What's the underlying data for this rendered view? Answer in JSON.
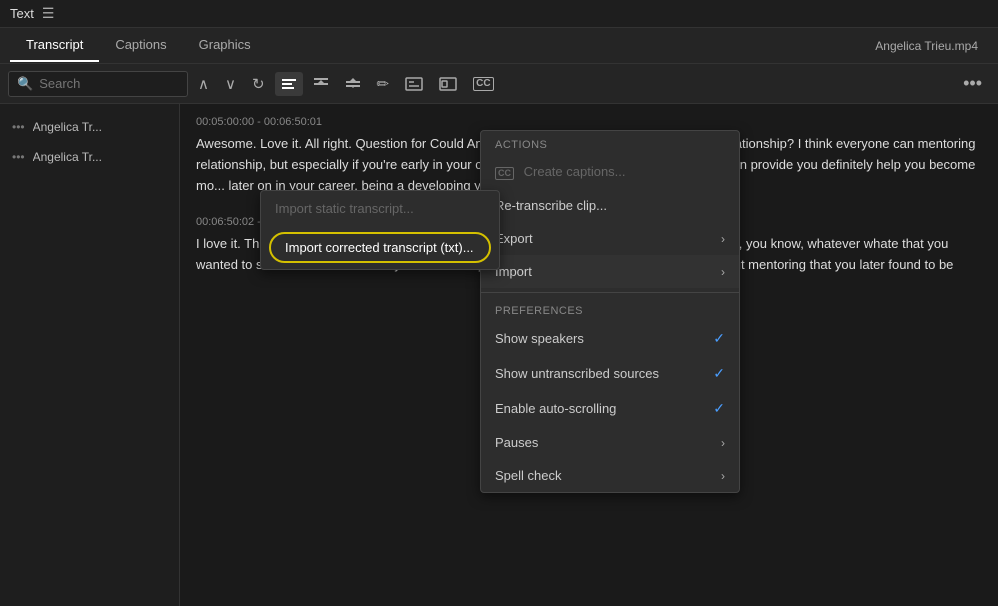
{
  "topbar": {
    "title": "Text",
    "menu_icon": "☰"
  },
  "tabs": {
    "items": [
      {
        "label": "Transcript",
        "active": true
      },
      {
        "label": "Captions",
        "active": false
      },
      {
        "label": "Graphics",
        "active": false
      }
    ],
    "file_label": "Angelica Trieu.mp4"
  },
  "toolbar": {
    "search_placeholder": "Search",
    "search_icon": "🔍",
    "nav_up_icon": "∧",
    "nav_down_icon": "∨",
    "refresh_icon": "↻",
    "align_icon": "≡",
    "split_icon": "⌥",
    "merge_icon": "⌂",
    "edit_icon": "✏",
    "caption_icon": "CC",
    "more_icon": "..."
  },
  "sidebar": {
    "items": [
      {
        "name": "Angelica Tr...",
        "dots": true
      },
      {
        "name": "Angelica Tr...",
        "dots": true
      }
    ]
  },
  "transcript": {
    "blocks": [
      {
        "id": "block1",
        "header": "00:05:00:00 - 00:06:50:01",
        "text": "Awesome. Love it. All right. Question for Could Angelica, who can benefit from a mentoring relationship? I think everyone can mentoring relationship, but especially if you're early in your career, Hearing about having a mentor that can provide you definitely help you become mo... later on in your career, being a developing your leadership ski..."
      },
      {
        "id": "block2",
        "header": "00:06:50:02 - 00:07:14:14",
        "text": "I love it. That's awesome. All right. So here comes the that th Yeah, the question five. So this is, you know, whatever whate that you wanted to share. So don't feel like you owe us anyt Question five Were there any stigmas about mentoring that you later found to be"
      }
    ]
  },
  "import_submenu": {
    "items": [
      {
        "label": "Import static transcript...",
        "disabled": true
      },
      {
        "label": "Import corrected transcript (txt)...",
        "highlighted": true
      }
    ]
  },
  "context_menu": {
    "sections": [
      {
        "label": "ACTIONS",
        "items": [
          {
            "label": "Create captions...",
            "disabled": true,
            "icon": "cc"
          },
          {
            "label": "Re-transcribe clip...",
            "has_arrow": false
          },
          {
            "label": "Export",
            "has_arrow": true
          },
          {
            "label": "Import",
            "has_arrow": true,
            "active": true
          }
        ]
      },
      {
        "label": "PREFERENCES",
        "items": [
          {
            "label": "Show speakers",
            "checked": true
          },
          {
            "label": "Show untranscribed sources",
            "checked": true
          },
          {
            "label": "Enable auto-scrolling",
            "checked": true
          },
          {
            "label": "Pauses",
            "has_arrow": true
          },
          {
            "label": "Spell check",
            "has_arrow": true
          }
        ]
      }
    ]
  },
  "colors": {
    "accent": "#4a9eff",
    "highlight_border": "#d4c000",
    "bg_dark": "#1a1a1a",
    "bg_panel": "#252525",
    "text_primary": "#ddd",
    "text_secondary": "#aaa"
  }
}
